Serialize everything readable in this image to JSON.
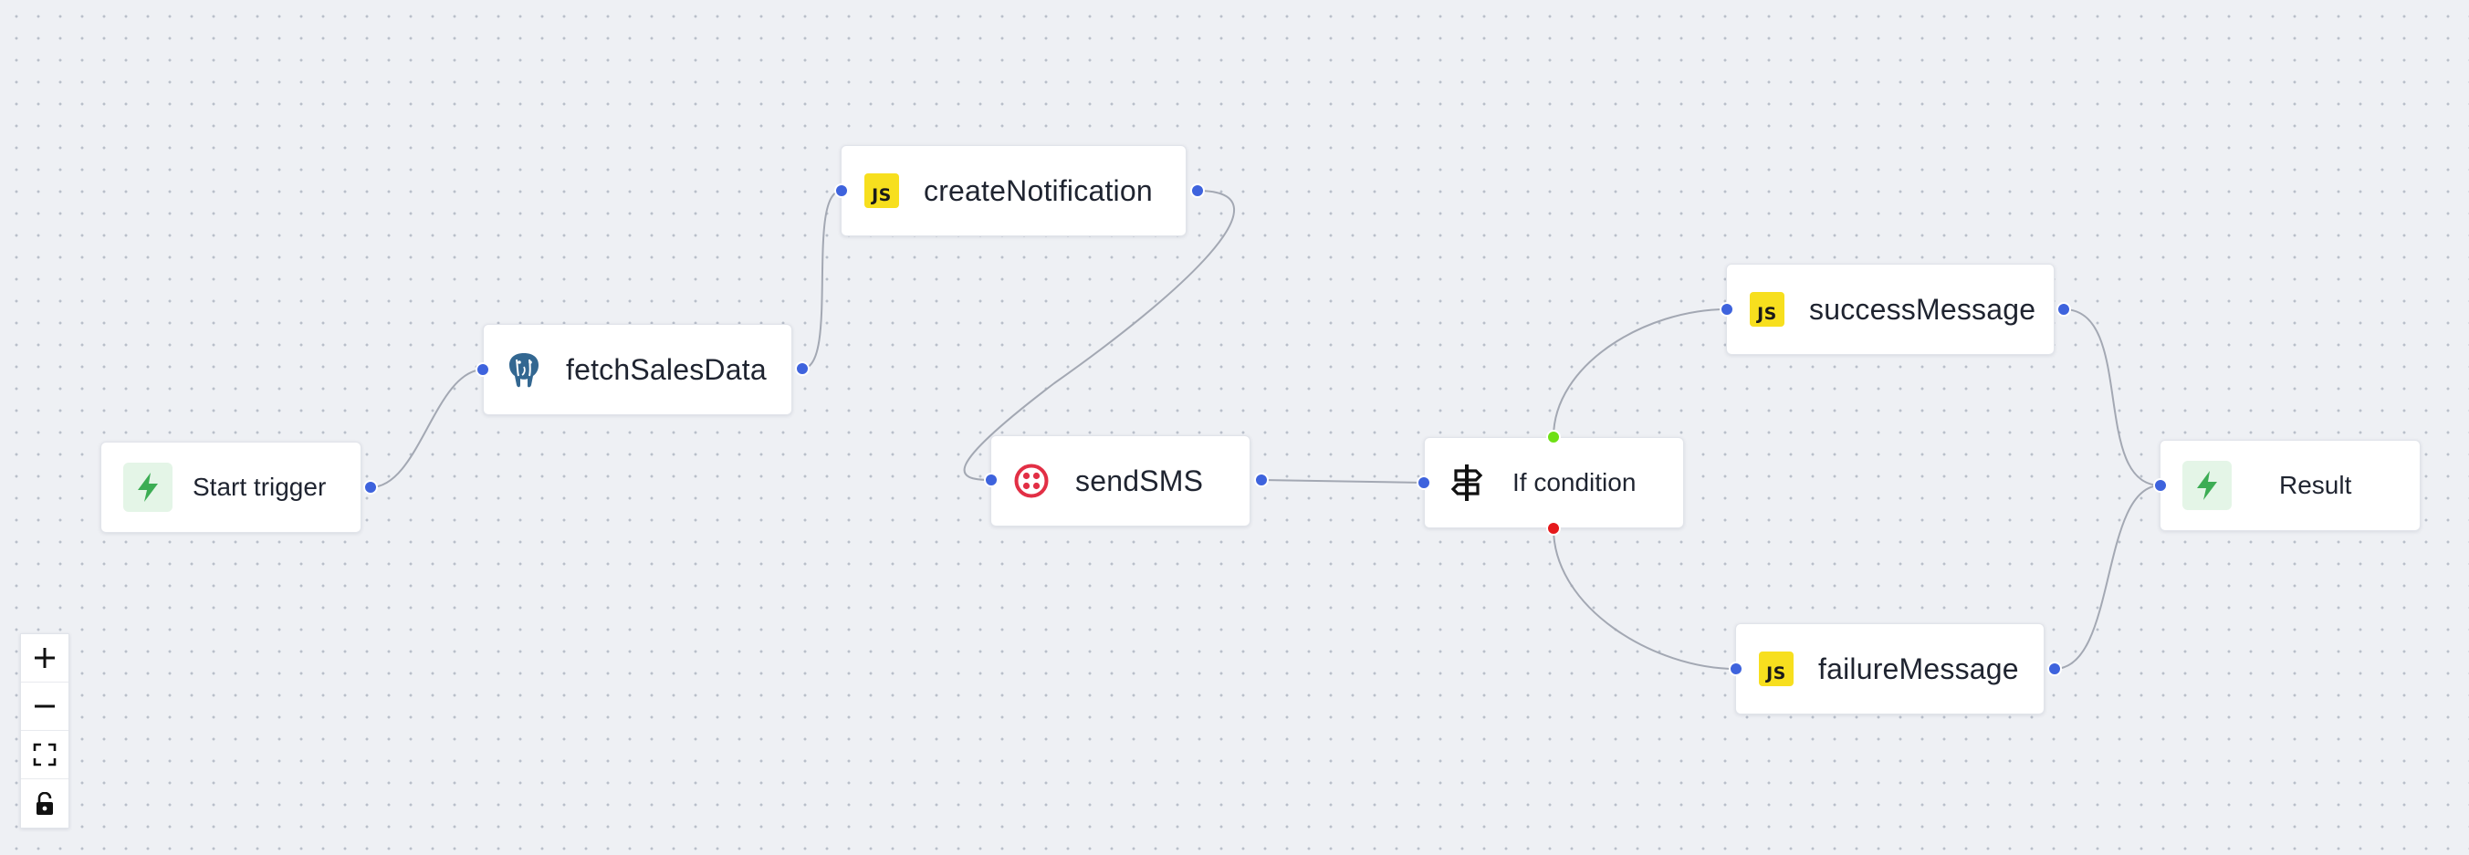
{
  "nodes": [
    {
      "id": "start",
      "label": "Start trigger",
      "icon": "bolt-icon"
    },
    {
      "id": "fetch",
      "label": "fetchSalesData",
      "icon": "postgres-icon"
    },
    {
      "id": "create",
      "label": "createNotification",
      "icon": "javascript-icon",
      "icon_text": "JS"
    },
    {
      "id": "sms",
      "label": "sendSMS",
      "icon": "twilio-icon"
    },
    {
      "id": "cond",
      "label": "If condition",
      "icon": "signpost-icon"
    },
    {
      "id": "success",
      "label": "successMessage",
      "icon": "javascript-icon",
      "icon_text": "JS"
    },
    {
      "id": "failure",
      "label": "failureMessage",
      "icon": "javascript-icon",
      "icon_text": "JS"
    },
    {
      "id": "result",
      "label": "Result",
      "icon": "bolt-icon"
    }
  ],
  "edges": [
    {
      "from": "start",
      "to": "fetch"
    },
    {
      "from": "fetch",
      "to": "create"
    },
    {
      "from": "create",
      "to": "sms"
    },
    {
      "from": "sms",
      "to": "cond"
    },
    {
      "from": "cond",
      "to": "success",
      "branch": "true"
    },
    {
      "from": "cond",
      "to": "failure",
      "branch": "false"
    },
    {
      "from": "success",
      "to": "result"
    },
    {
      "from": "failure",
      "to": "result"
    }
  ],
  "controls": [
    {
      "name": "zoom-in",
      "icon": "plus-icon"
    },
    {
      "name": "zoom-out",
      "icon": "minus-icon"
    },
    {
      "name": "fit-view",
      "icon": "fit-view-icon"
    },
    {
      "name": "lock",
      "icon": "lock-icon"
    }
  ],
  "colors": {
    "canvas": "#eef0f4",
    "dot": "#b9bfca",
    "handle": "#3e63dd",
    "handle_true": "#6ee015",
    "handle_false": "#e5181b",
    "edge": "#a3a8b3",
    "js_badge": "#f7df1e",
    "trigger_bg": "#e4f5e7",
    "trigger_icon": "#3cad54",
    "twilio": "#e22f45",
    "postgres": "#336791"
  }
}
